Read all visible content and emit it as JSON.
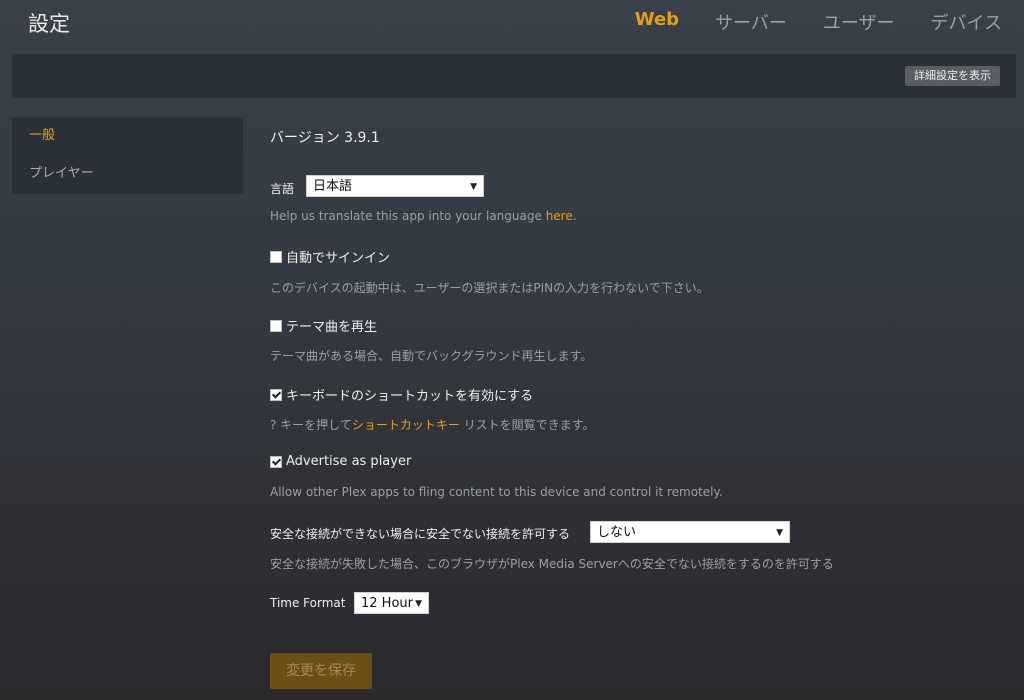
{
  "header": {
    "title": "設定",
    "nav": [
      {
        "label": "Web",
        "active": true
      },
      {
        "label": "サーバー",
        "active": false
      },
      {
        "label": "ユーザー",
        "active": false
      },
      {
        "label": "デバイス",
        "active": false
      }
    ]
  },
  "toolbar": {
    "advanced_button": "詳細設定を表示"
  },
  "sidebar": {
    "items": [
      {
        "label": "一般",
        "active": true
      },
      {
        "label": "プレイヤー",
        "active": false
      }
    ]
  },
  "settings": {
    "version": "バージョン 3.9.1",
    "language": {
      "label": "言語",
      "value": "日本語",
      "help_prefix": "Help us translate this app into your language ",
      "help_link": "here."
    },
    "auto_signin": {
      "label": "自動でサインイン",
      "checked": false,
      "help": "このデバイスの起動中は、ユーザーの選択またはPINの入力を行わないで下さい。"
    },
    "theme_music": {
      "label": "テーマ曲を再生",
      "checked": false,
      "help": "テーマ曲がある場合、自動でバックグラウンド再生します。"
    },
    "shortcuts": {
      "label": "キーボードのショートカットを有効にする",
      "checked": true,
      "help_prefix": "? キーを押して",
      "help_link": "ショートカットキー",
      "help_suffix": " リストを閲覧できます。"
    },
    "advertise": {
      "label": "Advertise as player",
      "checked": true,
      "help": "Allow other Plex apps to fling content to this device and control it remotely."
    },
    "insecure": {
      "label": "安全な接続ができない場合に安全でない接続を許可する",
      "value": "しない",
      "help": "安全な接続が失敗した場合、このブラウザがPlex Media Serverへの安全でない接続をするのを許可する"
    },
    "time_format": {
      "label": "Time Format",
      "value": "12 Hour"
    }
  },
  "actions": {
    "save_label": "変更を保存"
  },
  "colors": {
    "accent": "#e5a00d",
    "background": "#343a43"
  }
}
